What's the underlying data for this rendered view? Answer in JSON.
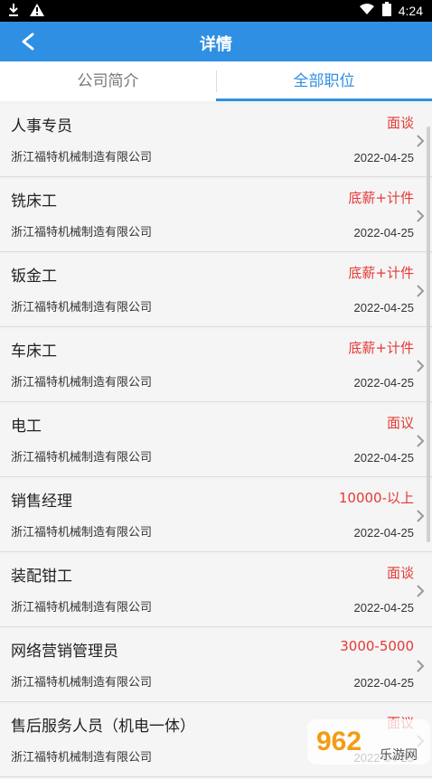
{
  "status_bar": {
    "time": "4:24"
  },
  "header": {
    "title": "详情"
  },
  "tabs": [
    {
      "label": "公司简介"
    },
    {
      "label": "全部职位"
    }
  ],
  "jobs": [
    {
      "title": "人事专员",
      "salary": "面谈",
      "company": "浙江福特机械制造有限公司",
      "date": "2022-04-25"
    },
    {
      "title": "铣床工",
      "salary": "底薪+计件",
      "company": "浙江福特机械制造有限公司",
      "date": "2022-04-25"
    },
    {
      "title": "钣金工",
      "salary": "底薪+计件",
      "company": "浙江福特机械制造有限公司",
      "date": "2022-04-25"
    },
    {
      "title": "车床工",
      "salary": "底薪+计件",
      "company": "浙江福特机械制造有限公司",
      "date": "2022-04-25"
    },
    {
      "title": "电工",
      "salary": "面议",
      "company": "浙江福特机械制造有限公司",
      "date": "2022-04-25"
    },
    {
      "title": "销售经理",
      "salary": "10000-以上",
      "company": "浙江福特机械制造有限公司",
      "date": "2022-04-25"
    },
    {
      "title": "装配钳工",
      "salary": "面谈",
      "company": "浙江福特机械制造有限公司",
      "date": "2022-04-25"
    },
    {
      "title": "网络营销管理员",
      "salary": "3000-5000",
      "company": "浙江福特机械制造有限公司",
      "date": "2022-04-25"
    },
    {
      "title": "售后服务人员（机电一体）",
      "salary": "面议",
      "company": "浙江福特机械制造有限公司",
      "date": "2022-04-25"
    }
  ],
  "watermark": {
    "text": "962",
    "sub": "乐游网"
  }
}
